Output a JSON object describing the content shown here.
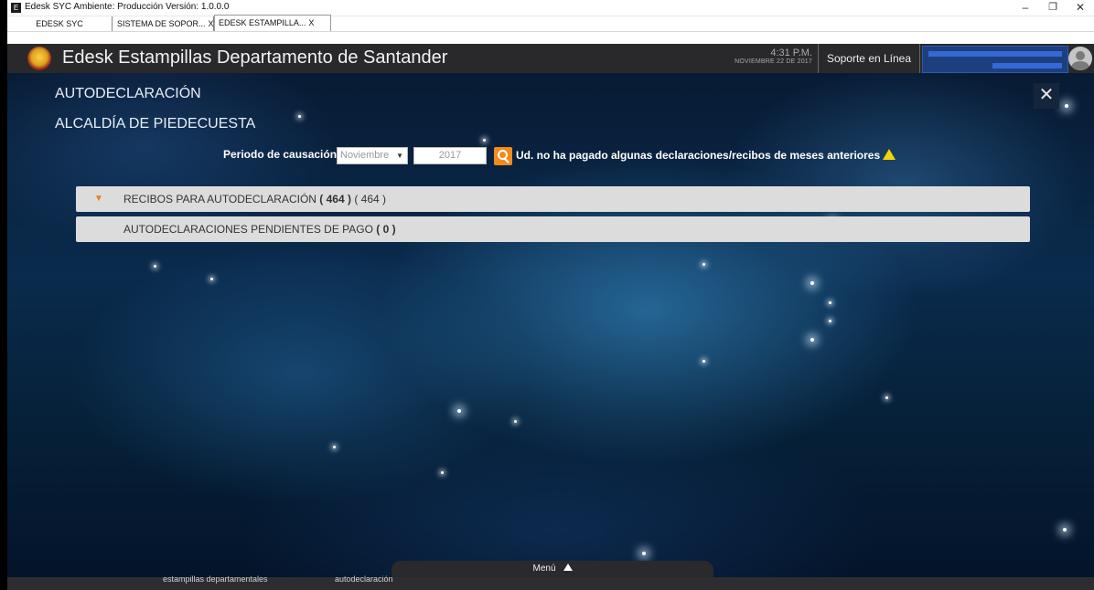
{
  "window": {
    "title": "Edesk SYC Ambiente: Producción Versión: 1.0.0.0",
    "minimize": "–",
    "maximize": "❐",
    "close": "✕"
  },
  "tabs": [
    {
      "label": "EDESK SYC",
      "close": ""
    },
    {
      "label": "SISTEMA DE SOPOR...",
      "close": "X"
    },
    {
      "label": "EDESK ESTAMPILLA...",
      "close": "X"
    }
  ],
  "header": {
    "title": "Edesk Estampillas Departamento de Santander",
    "time": "4:31 P.M.",
    "date": "NOVIEMBRE 22 DE 2017",
    "support": "Soporte en Línea"
  },
  "main": {
    "section": "AUTODECLARACIÓN",
    "entity": "ALCALDÍA DE PIEDECUESTA",
    "close": "✕",
    "period_label": "Periodo de causación",
    "month": "Noviembre",
    "year": "2017",
    "warning": "Ud. no ha pagado algunas declaraciones/recibos de meses anteriores",
    "panels": [
      {
        "label": "RECIBOS PARA AUTODECLARACIÓN",
        "count_bold": "( 464 )",
        "count": "( 464 )"
      },
      {
        "label": "AUTODECLARACIONES PENDIENTES DE PAGO",
        "count_bold": "( 0 )"
      }
    ]
  },
  "bottom": {
    "menu": "Menú",
    "crumbs": [
      "estampillas departamentales",
      "autodeclaración"
    ]
  },
  "colors": {
    "accent": "#f28b1e",
    "header_bg": "#29292b",
    "warning": "#f2d40a"
  },
  "icons": [
    "app-icon",
    "crest-icon",
    "avatar-icon",
    "search-icon",
    "warning-icon",
    "caret-down-icon",
    "close-icon",
    "triangle-up-icon"
  ]
}
